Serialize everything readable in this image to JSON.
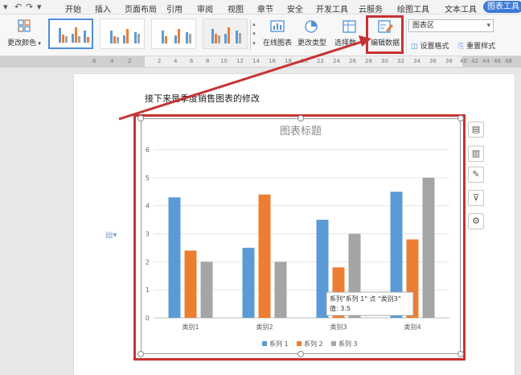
{
  "menubar": {
    "tabs": [
      "开始",
      "插入",
      "页面布局",
      "引用",
      "审阅",
      "视图",
      "章节",
      "安全",
      "开发工具",
      "云服务",
      "绘图工具",
      "文本工具"
    ],
    "active_tab": "图表工具"
  },
  "ribbon": {
    "change_color": "更改颜色",
    "online_chart": "在线图表",
    "change_type": "更改类型",
    "select_data": "选择数",
    "edit_data": "编辑数据",
    "area_select": "图表区",
    "set_format": "设置格式",
    "reset_style": "重置样式"
  },
  "ruler": {
    "ticks": [
      "6",
      "4",
      "2",
      "2",
      "4",
      "6",
      "8",
      "10",
      "12",
      "14",
      "16",
      "18",
      "20",
      "22",
      "24",
      "26",
      "28",
      "30",
      "32",
      "34",
      "36",
      "38",
      "40",
      "42",
      "44",
      "46",
      "48"
    ]
  },
  "document": {
    "text": "接下来是季度销售图表的修改"
  },
  "chart_data": {
    "type": "bar",
    "title": "图表标题",
    "categories": [
      "类别1",
      "类别2",
      "类别3",
      "类别4"
    ],
    "series": [
      {
        "name": "系列 1",
        "values": [
          4.3,
          2.5,
          3.5,
          4.5
        ],
        "color": "#5b9bd5"
      },
      {
        "name": "系列 2",
        "values": [
          2.4,
          4.4,
          1.8,
          2.8
        ],
        "color": "#ed7d31"
      },
      {
        "name": "系列 3",
        "values": [
          2,
          2,
          3,
          5
        ],
        "color": "#a5a5a5"
      }
    ],
    "yticks": [
      "0",
      "1",
      "2",
      "3",
      "4",
      "5",
      "6"
    ],
    "ylim": [
      0,
      6
    ],
    "legend": "bottom",
    "tooltip": {
      "line1": "系列\"系列 1\" 点 \"类别3\"",
      "line2": "值: 3.5"
    }
  }
}
